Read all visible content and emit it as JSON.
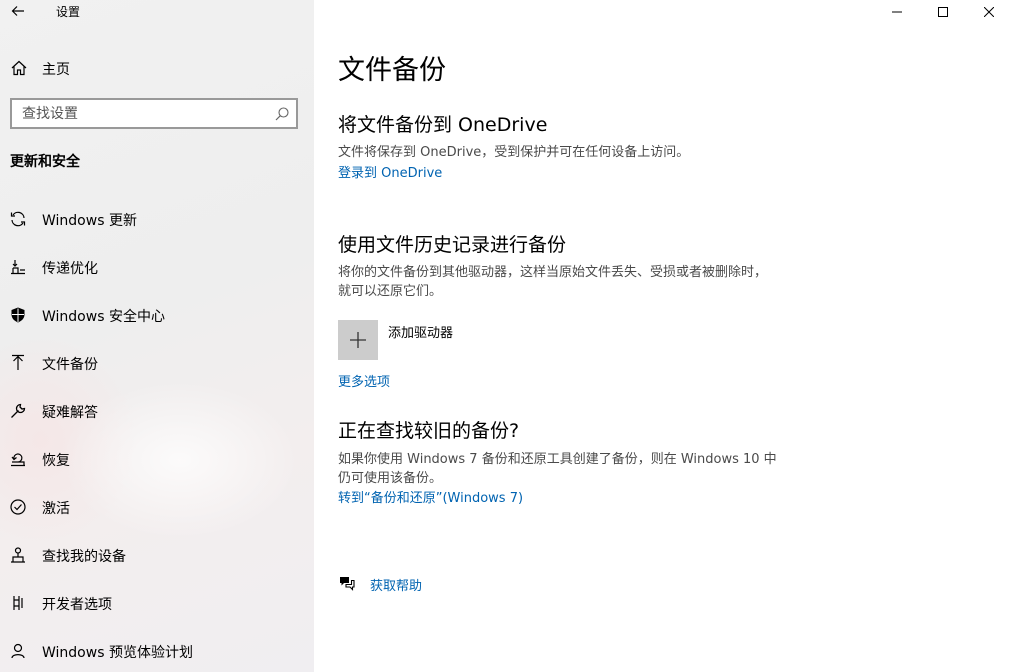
{
  "window": {
    "title": "设置",
    "minimize_glyph": "—",
    "maximize_glyph": "☐",
    "close_glyph": "✕"
  },
  "sidebar": {
    "home_label": "主页",
    "search_placeholder": "查找设置",
    "section_title": "更新和安全",
    "items": [
      {
        "label": "Windows 更新",
        "icon": "sync-icon"
      },
      {
        "label": "传递优化",
        "icon": "delivery-optimization-icon"
      },
      {
        "label": "Windows 安全中心",
        "icon": "shield-icon"
      },
      {
        "label": "文件备份",
        "icon": "backup-arrow-icon"
      },
      {
        "label": "疑难解答",
        "icon": "wrench-icon"
      },
      {
        "label": "恢复",
        "icon": "recovery-icon"
      },
      {
        "label": "激活",
        "icon": "checkmark-circle-icon"
      },
      {
        "label": "查找我的设备",
        "icon": "find-device-icon"
      },
      {
        "label": "开发者选项",
        "icon": "developer-icon"
      },
      {
        "label": "Windows 预览体验计划",
        "icon": "insider-icon"
      }
    ],
    "active_index": 3
  },
  "main": {
    "page_title": "文件备份",
    "onedrive": {
      "heading": "将文件备份到 OneDrive",
      "description": "文件将保存到 OneDrive，受到保护并可在任何设备上访问。",
      "link": "登录到 OneDrive"
    },
    "file_history": {
      "heading": "使用文件历史记录进行备份",
      "description": "将你的文件备份到其他驱动器，这样当原始文件丢失、受损或者被删除时，就可以还原它们。",
      "add_drive_label": "添加驱动器",
      "more_options_link": "更多选项"
    },
    "older_backup": {
      "heading": "正在查找较旧的备份?",
      "description": "如果你使用 Windows 7 备份和还原工具创建了备份，则在 Windows 10 中仍可使用该备份。",
      "link": "转到“备份和还原”(Windows 7)"
    },
    "help_link": "获取帮助"
  },
  "colors": {
    "link": "#0063b1",
    "sidebar_bg": "#efefef",
    "add_drive_bg": "#cccccc"
  }
}
